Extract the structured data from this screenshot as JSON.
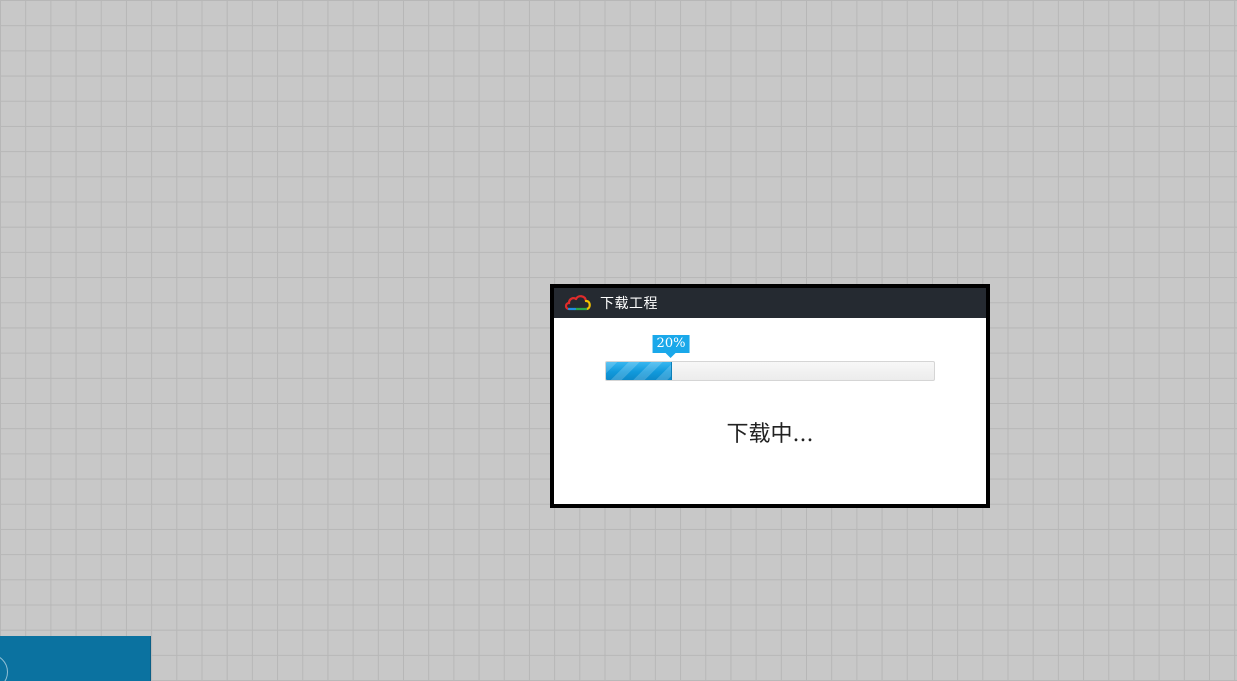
{
  "dialog": {
    "title": "下载工程",
    "logo_icon": "cloud-icon",
    "progress": {
      "percent": 20,
      "label": "20%"
    },
    "status": "下载中..."
  },
  "colors": {
    "titlebar": "#252a31",
    "progress_fill": "#1199db",
    "background_grid": "#c8c8c8",
    "corner_panel": "#0b72a0"
  }
}
